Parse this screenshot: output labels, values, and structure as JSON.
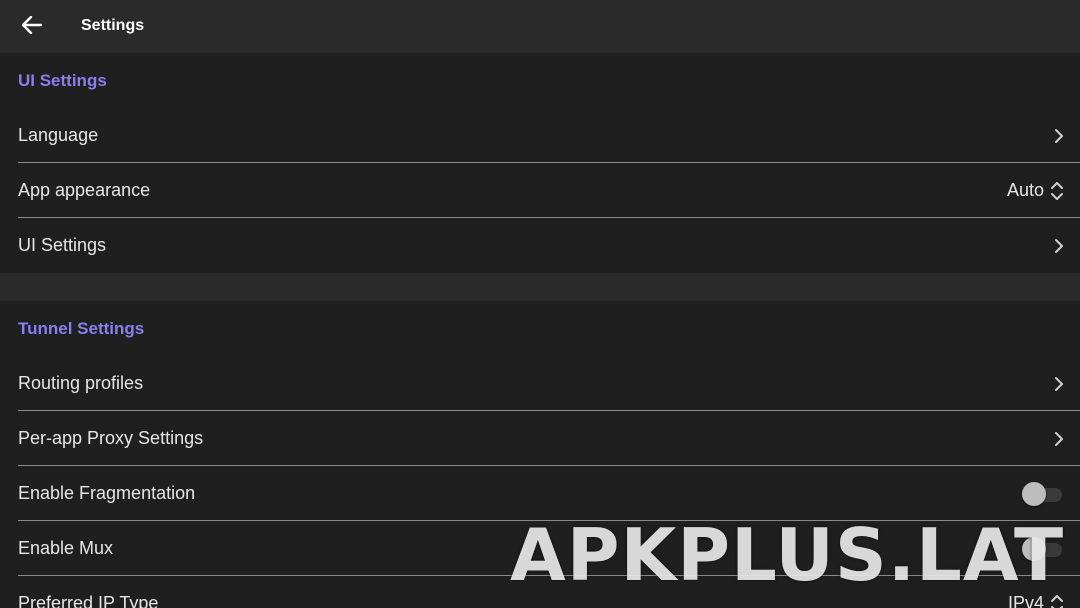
{
  "topbar": {
    "title": "Settings",
    "back_icon": "arrow-left-icon"
  },
  "ui_settings": {
    "header": "UI Settings",
    "rows": [
      {
        "label": "Language",
        "control": "chevron-right-icon"
      },
      {
        "label": "App appearance",
        "value": "Auto",
        "control": "up-down-chevron-icon"
      },
      {
        "label": "UI Settings",
        "control": "chevron-right-icon"
      }
    ]
  },
  "tunnel_settings": {
    "header": "Tunnel Settings",
    "rows": [
      {
        "label": "Routing profiles",
        "control": "chevron-right-icon"
      },
      {
        "label": "Per-app Proxy Settings",
        "control": "chevron-right-icon"
      },
      {
        "label": "Enable Fragmentation",
        "control": "toggle",
        "enabled": false
      },
      {
        "label": "Enable Mux",
        "control": "toggle",
        "enabled": false
      },
      {
        "label": "Preferred IP Type",
        "value": "IPv4",
        "control": "up-down-chevron-icon"
      }
    ]
  },
  "watermark": {
    "text": "APKPLUS.LAT"
  },
  "colors": {
    "background": "#1f1f1f",
    "topbar": "#2a2a2a",
    "section_header": "#8b7df2",
    "text": "#e6e6e6",
    "divider": "#8a8a8a"
  }
}
